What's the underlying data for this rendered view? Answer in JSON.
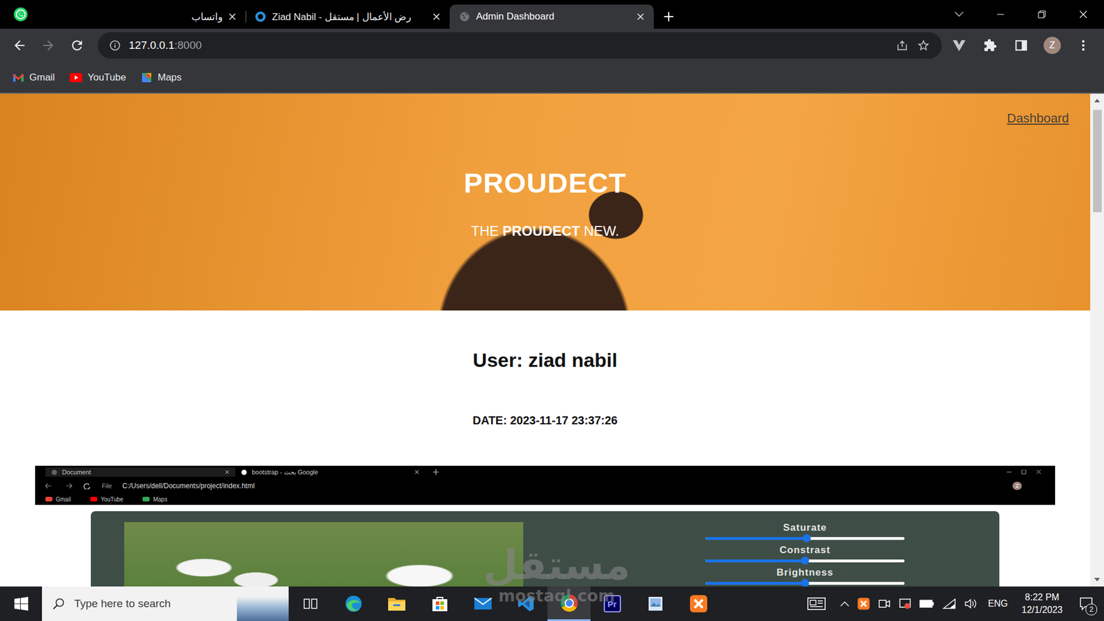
{
  "browser": {
    "tabs": [
      {
        "label": "واتساب",
        "kind": "plain",
        "selected": false
      },
      {
        "label": "Ziad Nabil - رض الأعمال | مستقل",
        "kind": "site",
        "selected": false
      },
      {
        "label": "Admin Dashboard",
        "kind": "globe",
        "selected": true
      }
    ],
    "back_enabled": true,
    "forward_enabled": false,
    "url": {
      "host": "127.0.0.1",
      "port": ":8000"
    },
    "profile": "Z",
    "bookmarks": [
      {
        "label": "Gmail",
        "kind": "gmail"
      },
      {
        "label": "YouTube",
        "kind": "youtube"
      },
      {
        "label": "Maps",
        "kind": "maps"
      }
    ]
  },
  "page": {
    "nav_link": "Dashboard",
    "hero_title": "PROUDECT",
    "hero_subtitle": [
      {
        "text": "THE ",
        "bold": false
      },
      {
        "text": "PROUDECT",
        "bold": true
      },
      {
        "text": " NEW.",
        "bold": false
      }
    ],
    "user": "User: ziad nabil",
    "date": "DATE: 2023-11-17 23:37:26",
    "shot": {
      "tabs": [
        {
          "label": "Document",
          "selected": true
        },
        {
          "label": "bootstrap - بحث Google",
          "selected": false
        }
      ],
      "url": {
        "scheme": "File",
        "path": "C:/Users/dell/Documents/project/index.html"
      },
      "profile": "Z",
      "bookmarks": [
        {
          "label": "Gmail",
          "kind": "gmail"
        },
        {
          "label": "YouTube",
          "kind": "youtube"
        },
        {
          "label": "Maps",
          "kind": "maps"
        }
      ],
      "sliders": [
        {
          "label": "Saturate",
          "level": 0.51
        },
        {
          "label": "Constrast",
          "level": 0.5
        },
        {
          "label": "Brightness",
          "level": 0.5
        }
      ]
    }
  },
  "watermark": {
    "arabic": "مستقل",
    "latin": "mostaql.com"
  },
  "taskbar": {
    "search_placeholder": "Type here to search",
    "apps": [
      {
        "kind": "task-view",
        "active": false
      },
      {
        "kind": "edge",
        "active": false
      },
      {
        "kind": "explorer",
        "active": false
      },
      {
        "kind": "store",
        "active": false
      },
      {
        "kind": "mail",
        "active": false
      },
      {
        "kind": "vscode",
        "active": false
      },
      {
        "kind": "chrome",
        "active": true
      },
      {
        "kind": "premiere",
        "active": false,
        "badge": "Pr"
      },
      {
        "kind": "viewer",
        "active": false
      },
      {
        "kind": "xampp",
        "active": false
      }
    ],
    "tray": {
      "language": "ENG",
      "time": "8:22 PM",
      "date": "12/1/2023",
      "notifications": "2"
    }
  }
}
